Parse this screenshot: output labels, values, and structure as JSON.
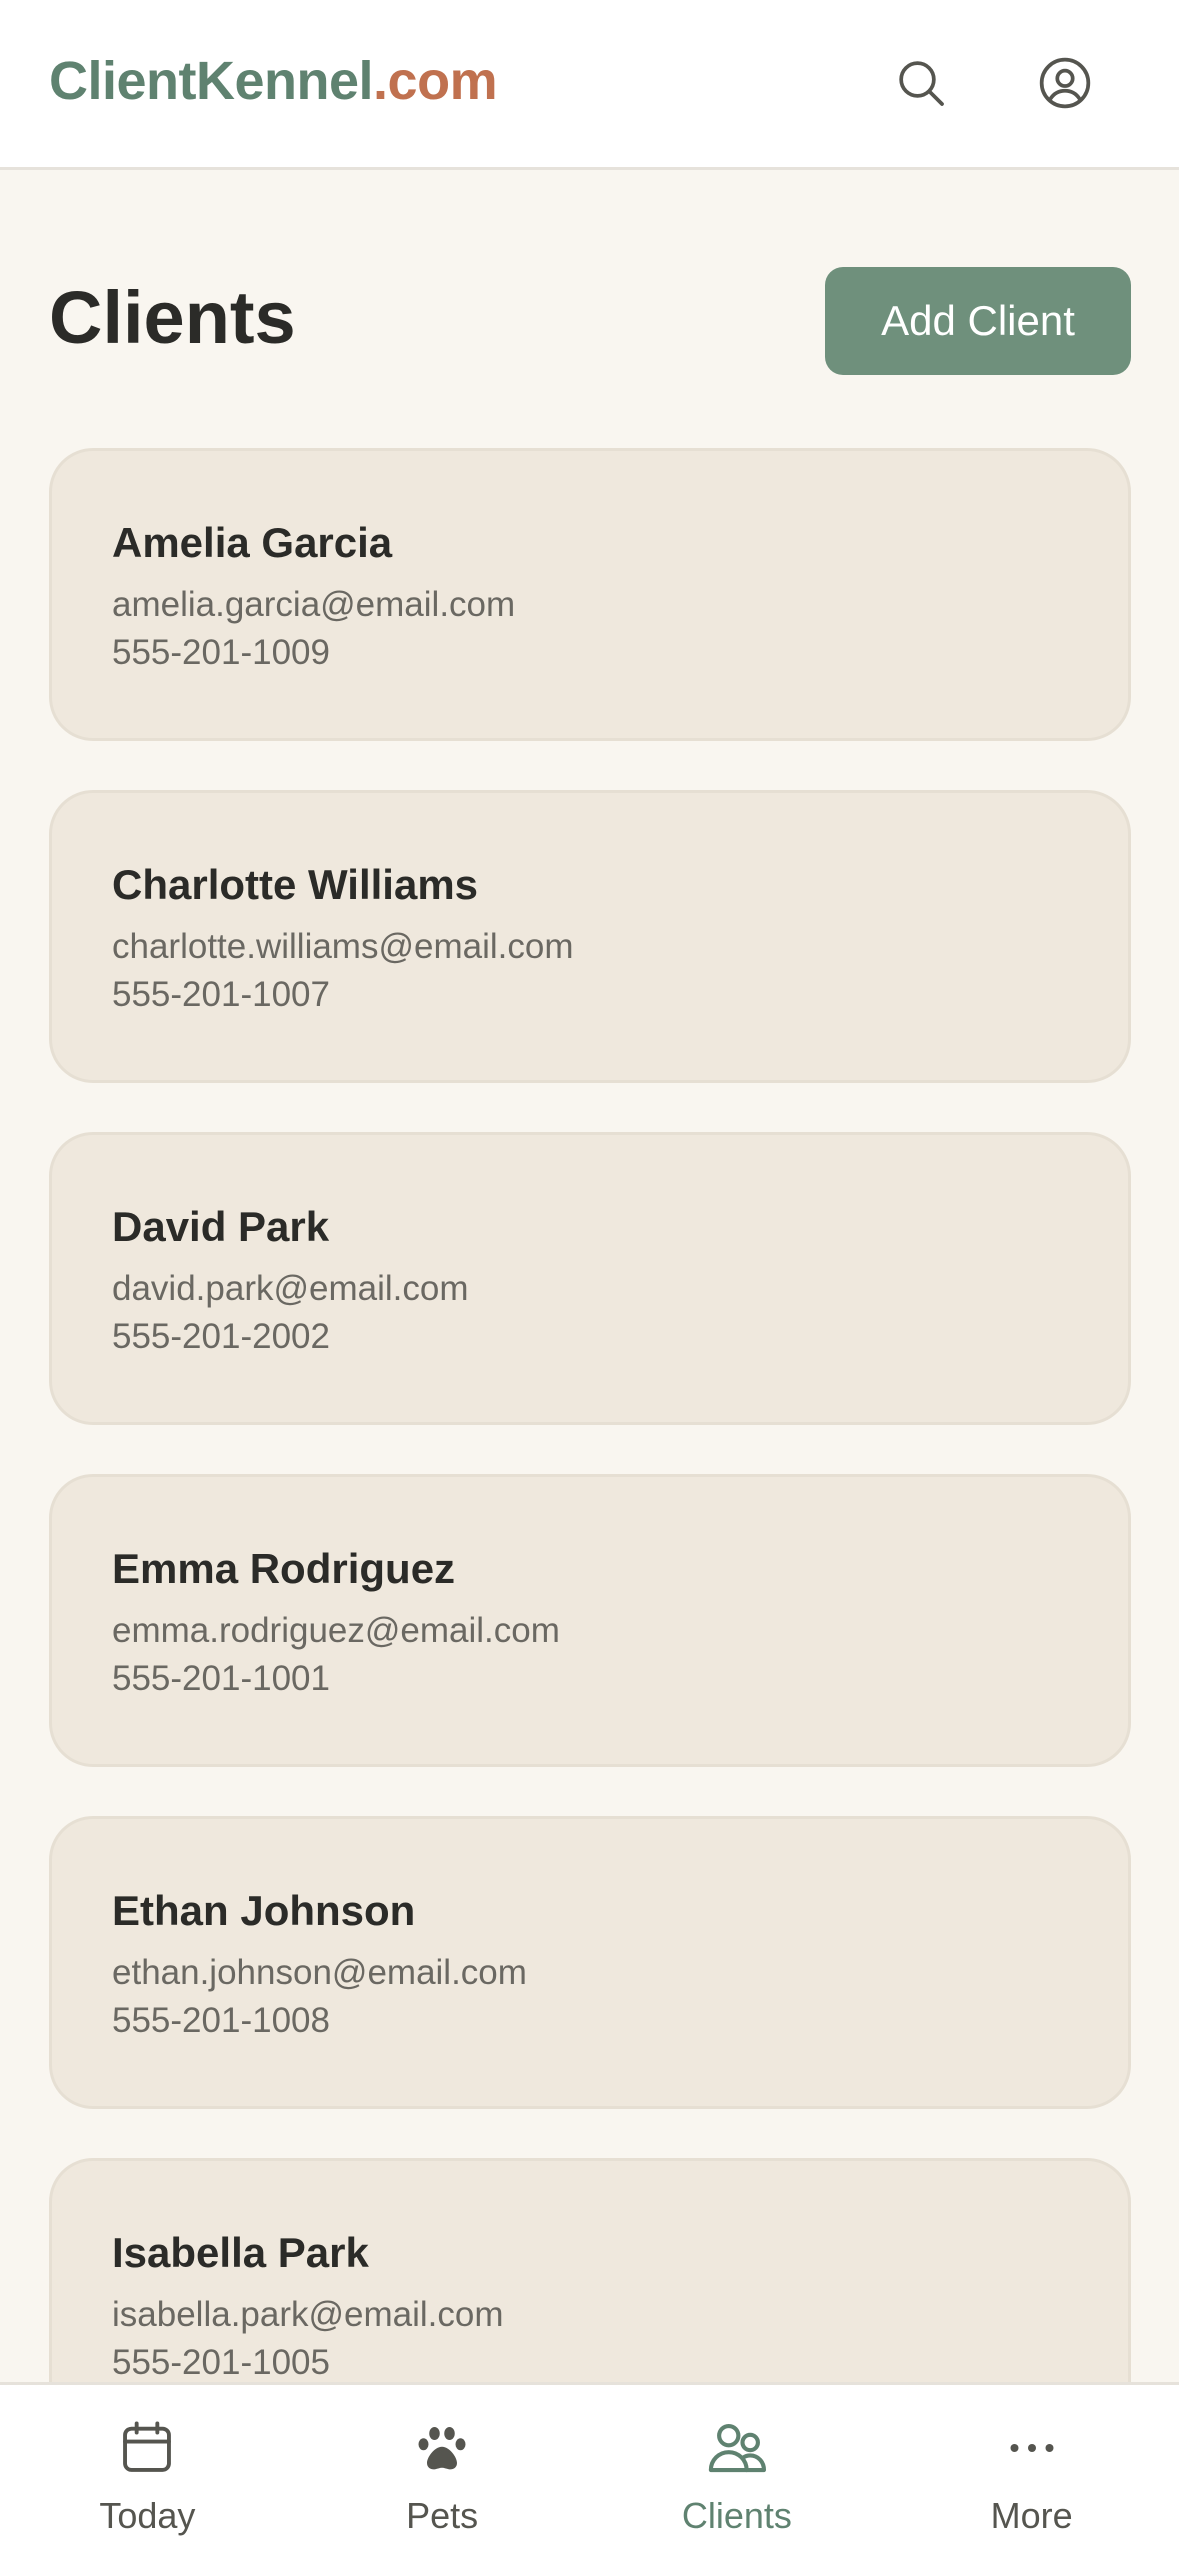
{
  "header": {
    "logo_main": "ClientKennel",
    "logo_tld": ".com",
    "search_icon": "search-icon",
    "profile_icon": "user-circle-icon"
  },
  "main": {
    "title": "Clients",
    "add_button_label": "Add Client",
    "clients": [
      {
        "name": "Amelia Garcia",
        "email": "amelia.garcia@email.com",
        "phone": "555-201-1009"
      },
      {
        "name": "Charlotte Williams",
        "email": "charlotte.williams@email.com",
        "phone": "555-201-1007"
      },
      {
        "name": "David Park",
        "email": "david.park@email.com",
        "phone": "555-201-2002"
      },
      {
        "name": "Emma Rodriguez",
        "email": "emma.rodriguez@email.com",
        "phone": "555-201-1001"
      },
      {
        "name": "Ethan Johnson",
        "email": "ethan.johnson@email.com",
        "phone": "555-201-1008"
      },
      {
        "name": "Isabella Park",
        "email": "isabella.park@email.com",
        "phone": "555-201-1005"
      }
    ]
  },
  "tabbar": {
    "tabs": [
      {
        "label": "Today",
        "icon": "calendar-icon"
      },
      {
        "label": "Pets",
        "icon": "paw-icon"
      },
      {
        "label": "Clients",
        "icon": "users-icon",
        "active": true
      },
      {
        "label": "More",
        "icon": "more-horizontal-icon"
      }
    ]
  },
  "colors": {
    "brand_green": "#5f8270",
    "brand_orange": "#c0714f",
    "button_green": "#6f907c",
    "card_bg": "#efe8dd",
    "page_bg": "#f9f6f0"
  }
}
